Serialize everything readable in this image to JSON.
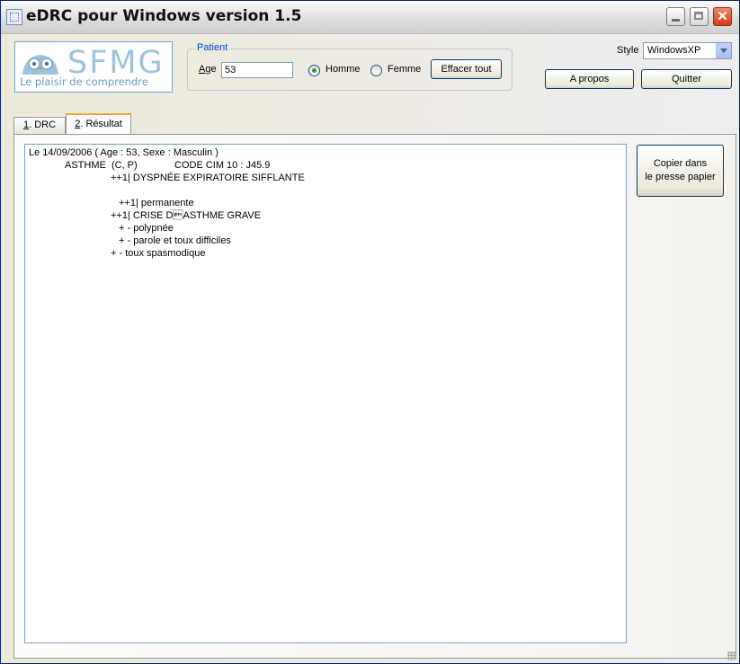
{
  "window": {
    "title": "eDRC pour Windows version 1.5",
    "close_glyph": "✕"
  },
  "logo": {
    "text": "SFMG",
    "tagline": "Le plaisir de comprendre"
  },
  "patient": {
    "legend": "Patient",
    "age_label": "Age",
    "age_value": "53",
    "sex_options": [
      {
        "label": "Homme",
        "selected": true
      },
      {
        "label": "Femme",
        "selected": false
      }
    ],
    "clear_label": "Effacer tout"
  },
  "style": {
    "label": "Style",
    "selected": "WindowsXP"
  },
  "buttons": {
    "about": "A propos",
    "quit": "Quitter",
    "copy_line1": "Copier dans",
    "copy_line2": "le presse papier"
  },
  "tabs": [
    {
      "num": "1",
      "label": ". DRC",
      "active": false
    },
    {
      "num": "2",
      "label": ". Résultat",
      "active": true
    }
  ],
  "result": {
    "lines": [
      "Le 14/09/2006 ( Age : 53, Sexe : Masculin )",
      "ASTHME  (C, P)",
      "CODE CIM 10 : J45.9",
      "++1| DYSPNÉE EXPIRATOIRE SIFFLANTE",
      "++1| permanente",
      "++1| CRISE D\u0019ASTHME GRAVE",
      "+ - polypnée",
      "+ - parole et toux difficiles",
      "+ - toux spasmodique"
    ]
  },
  "colors": {
    "accent": "#0046d5",
    "tab_highlight": "#f1a83c",
    "logo": "#9fc3dd"
  }
}
